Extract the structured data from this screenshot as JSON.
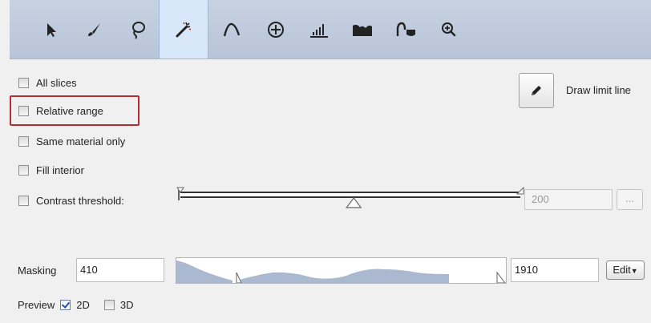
{
  "toolbar": {
    "tools": [
      {
        "icon": "pointer-arrow-icon"
      },
      {
        "icon": "brush-icon"
      },
      {
        "icon": "lasso-icon"
      },
      {
        "icon": "magic-wand-icon",
        "active": true
      },
      {
        "icon": "curve-peak-icon"
      },
      {
        "icon": "crosshair-circle-icon"
      },
      {
        "icon": "histogram-bars-icon"
      },
      {
        "icon": "mountain-profile-icon"
      },
      {
        "icon": "wave-fill-icon"
      },
      {
        "icon": "zoom-in-icon"
      }
    ],
    "accent": "#d9e7fb"
  },
  "options": {
    "all_slices": {
      "label": "All slices",
      "checked": false
    },
    "relative_range": {
      "label": "Relative range",
      "checked": false
    },
    "same_material": {
      "label": "Same material only",
      "checked": false
    },
    "fill_interior": {
      "label": "Fill interior",
      "checked": false
    },
    "contrast_threshold": {
      "label": "Contrast threshold:",
      "checked": false
    }
  },
  "draw_limit": {
    "label": "Draw limit line",
    "icon": "pencil-icon"
  },
  "contrast": {
    "value": "200",
    "more_label": "...",
    "slider_position": 0.51
  },
  "masking": {
    "label": "Masking",
    "min_value": "410",
    "max_value": "1910",
    "edit_label": "Edit"
  },
  "preview": {
    "label": "Preview",
    "options": [
      {
        "label": "2D",
        "checked": true
      },
      {
        "label": "3D",
        "checked": false
      }
    ]
  },
  "colors": {
    "highlight_border": "#b52d34",
    "histogram_fill": "#aab9cf"
  }
}
